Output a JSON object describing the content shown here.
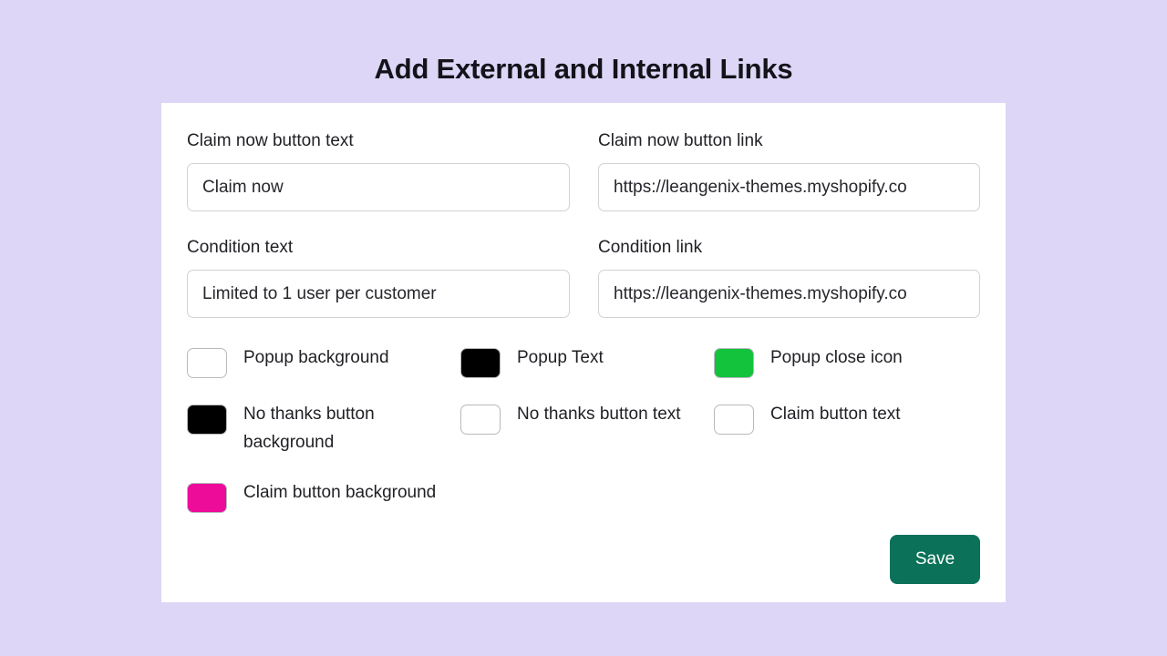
{
  "page": {
    "title": "Add External and Internal Links",
    "background_color": "#ddd6f6",
    "card_background": "#ffffff"
  },
  "form": {
    "fields": [
      {
        "label": "Claim now button text",
        "value": "Claim now",
        "name": "claim-now-button-text"
      },
      {
        "label": "Claim now button link",
        "value": "https://leangenix-themes.myshopify.co",
        "name": "claim-now-button-link"
      },
      {
        "label": "Condition text",
        "value": "Limited to 1 user per customer",
        "name": "condition-text"
      },
      {
        "label": "Condition link",
        "value": "https://leangenix-themes.myshopify.co",
        "name": "condition-link"
      }
    ]
  },
  "colors": {
    "swatches": [
      {
        "label": "Popup background",
        "color": "#ffffff",
        "name": "popup-background"
      },
      {
        "label": "Popup Text",
        "color": "#000000",
        "name": "popup-text"
      },
      {
        "label": "Popup close icon",
        "color": "#14c33c",
        "name": "popup-close-icon"
      },
      {
        "label": "No thanks button background",
        "color": "#000000",
        "name": "no-thanks-button-background"
      },
      {
        "label": "No thanks button text",
        "color": "#ffffff",
        "name": "no-thanks-button-text"
      },
      {
        "label": "Claim button text",
        "color": "#ffffff",
        "name": "claim-button-text"
      },
      {
        "label": "Claim button background",
        "color": "#ed0b9a",
        "name": "claim-button-background"
      }
    ]
  },
  "footer": {
    "save_label": "Save",
    "save_color": "#0b7259"
  }
}
